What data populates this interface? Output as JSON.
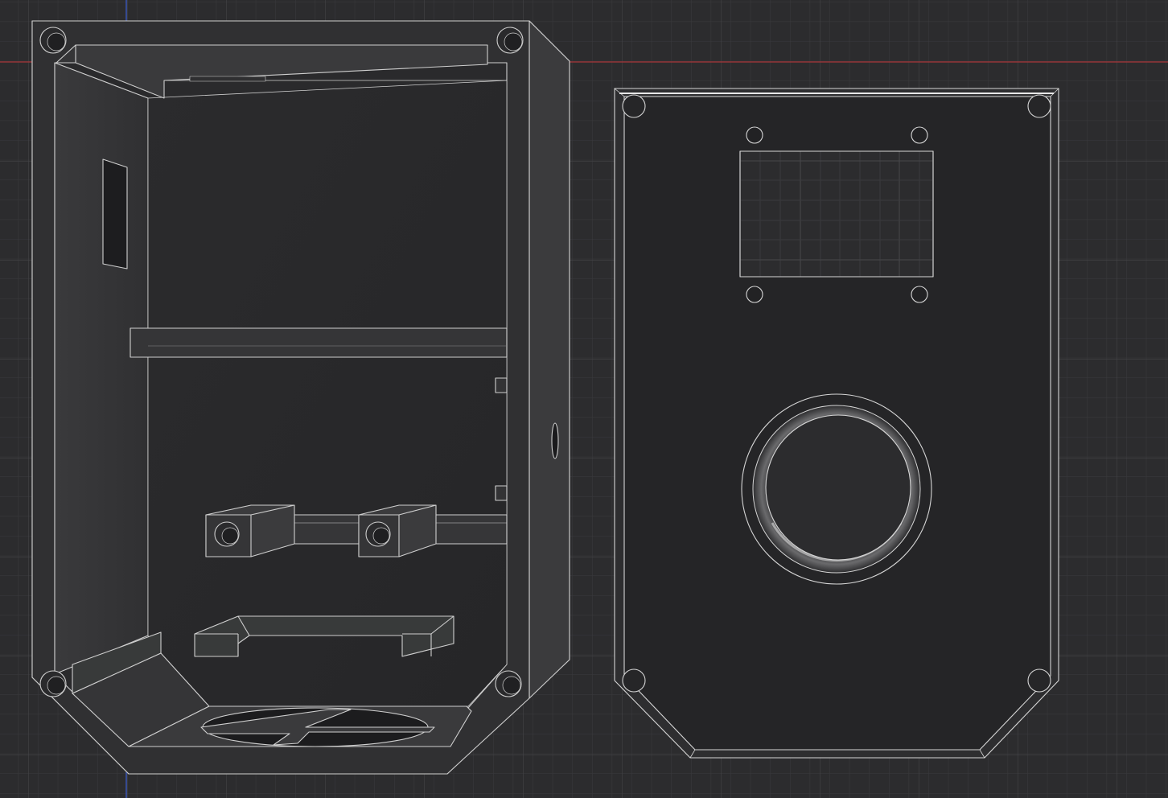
{
  "viewport": {
    "background": "#2c2c2e",
    "grid_minor_color": "#3a3a3d",
    "grid_major_color": "#444448",
    "axis_x_color": "#b8383b",
    "axis_y_color": "#3c5fd6"
  },
  "models": {
    "enclosure_base": {
      "label": "",
      "body_color": "#2a2a2c",
      "edge_color": "#d0d0d0"
    },
    "enclosure_lid": {
      "label": "",
      "body_color": "#252527",
      "edge_color": "#d8d8d8"
    }
  }
}
